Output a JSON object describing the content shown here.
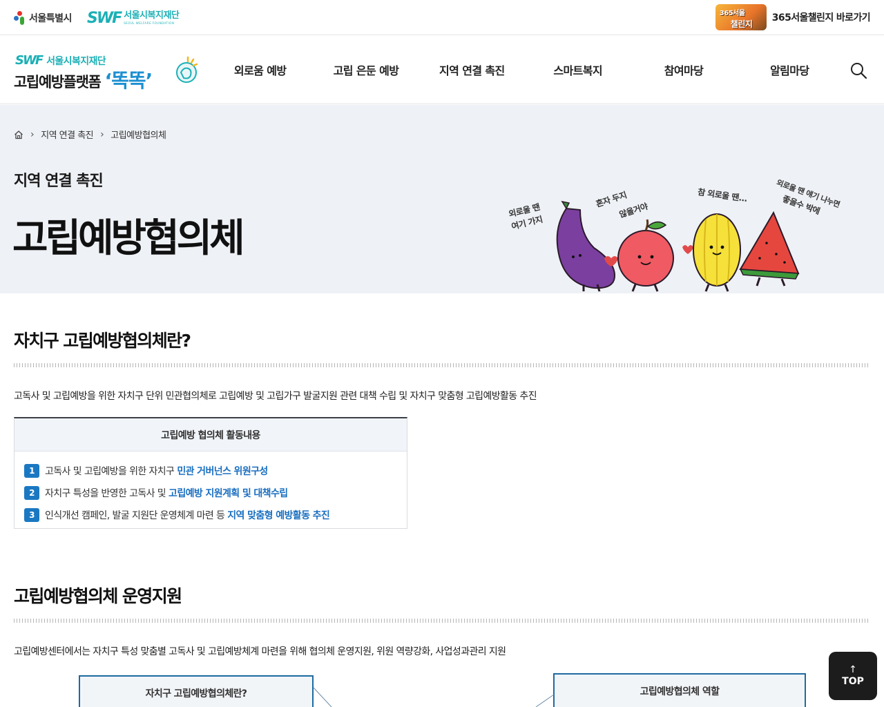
{
  "topbar": {
    "seoul_logo_text": "서울특별시",
    "foundation_logo_mark": "SWF",
    "foundation_logo_text": "서울시복지재단",
    "foundation_logo_en": "SEOUL WELFARE FOUNDATION",
    "challenge_badge_line1": "365서울",
    "challenge_badge_line2": "챌린지",
    "challenge_link": "365서울챌린지 바로가기"
  },
  "header": {
    "brand_mark": "SWF",
    "brand_org": "서울시복지재단",
    "brand_name": "고립예방플랫폼",
    "brand_highlight": "‘똑똑’",
    "nav": [
      "외로움 예방",
      "고립 은둔 예방",
      "지역 연결 촉진",
      "스마트복지",
      "참여마당",
      "알림마당"
    ],
    "search_icon": "search-icon"
  },
  "subvisual": {
    "breadcrumb": [
      "지역 연결 촉진",
      "고립예방협의체"
    ],
    "home_icon": "home-icon",
    "section_label": "지역 연결 촉진",
    "page_title": "고립예방협의체",
    "char_text_1a": "외로울 땐",
    "char_text_1b": "여기 가지",
    "char_text_2a": "혼자 두지",
    "char_text_2b": "않을거야",
    "char_text_3": "참 외로울 땐...",
    "char_text_4a": "외로울 땐 얘기 나누면",
    "char_text_4b": "좋을수 박에"
  },
  "section1": {
    "heading": "자치구 고립예방협의체란?",
    "description": "고독사 및 고립예방을 위한 자치구 단위 민관협의체로 고립예방 및 고립가구 발굴지원 관련 대책 수립 및 자치구 맞춤형 고립예방활동 추진",
    "box_title": "고립예방 협의체 활동내용",
    "items": [
      {
        "num": "1",
        "text": "고독사 및 고립예방을 위한 자치구",
        "highlight": "민관 거버넌스 위원구성"
      },
      {
        "num": "2",
        "text": "자치구 특성을 반영한 고독사 및",
        "highlight": "고립예방 지원계획 및 대책수립"
      },
      {
        "num": "3",
        "text": "인식개선 캠페인, 발굴 지원단 운영체계 마련 등",
        "highlight": "지역 맞춤형 예방활동 추진"
      }
    ]
  },
  "section2": {
    "heading": "고립예방협의체 운영지원",
    "description": "고립예방센터에서는 자치구 특성 맞춤별 고독사 및 고립예방체계 마련을 위해 협의체 운영지원, 위원 역량강화, 사업성과관리 지원",
    "box_left": "자치구 고립예방협의체란?",
    "box_right": "고립예방협의체 역할"
  },
  "top_button": {
    "arrow": "↑",
    "label": "TOP"
  },
  "colors": {
    "accent": "#1bb0b6",
    "brand_blue": "#1c8fd0",
    "link_blue": "#1a6fc0",
    "badge_blue": "#1a78c2",
    "subvisual_bg": "#eef1f5"
  }
}
